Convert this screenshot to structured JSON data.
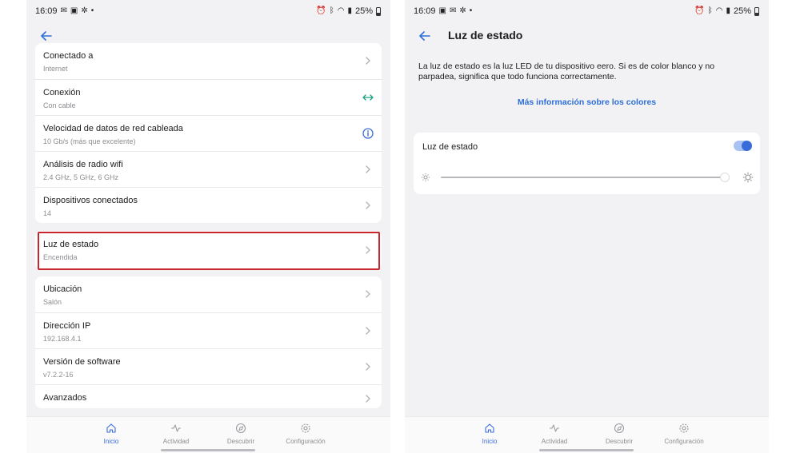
{
  "status_bar": {
    "time": "16:09",
    "battery": "25%"
  },
  "left": {
    "device_rows": [
      {
        "label": "Conectado a",
        "sub": "Internet",
        "action": "chevron-right"
      },
      {
        "label": "Conexión",
        "sub": "Con cable",
        "action": "link-arrows"
      },
      {
        "label": "Velocidad de datos de red cableada",
        "sub": "10 Gb/s (más que excelente)",
        "action": "info"
      },
      {
        "label": "Análisis de radio wifi",
        "sub": "2.4 GHz, 5 GHz, 6 GHz",
        "action": "chevron-right"
      },
      {
        "label": "Dispositivos conectados",
        "sub": "14",
        "action": "chevron-right"
      }
    ],
    "status_row": {
      "label": "Luz de estado",
      "sub": "Encendida",
      "action": "chevron-right"
    },
    "info_rows": [
      {
        "label": "Ubicación",
        "sub": "Salón",
        "action": "chevron-right"
      },
      {
        "label": "Dirección IP",
        "sub": "192.168.4.1",
        "action": "chevron-right"
      },
      {
        "label": "Versión de software",
        "sub": "v7.2.2-16",
        "action": "chevron-right"
      },
      {
        "label": "Avanzados",
        "sub": "",
        "action": "chevron-right"
      }
    ]
  },
  "right": {
    "title": "Luz de estado",
    "description": "La luz de estado es la luz LED de tu dispositivo eero. Si es de color blanco y no parpadea, significa que todo funciona correctamente.",
    "link": "Más información sobre los colores",
    "toggle_label": "Luz de estado",
    "toggle_on": true,
    "brightness_fraction": 1.0
  },
  "tabs": [
    {
      "label": "Inicio",
      "icon": "home-icon",
      "active": true
    },
    {
      "label": "Actividad",
      "icon": "activity-icon",
      "active": false
    },
    {
      "label": "Descubrir",
      "icon": "discover-icon",
      "active": false
    },
    {
      "label": "Configuración",
      "icon": "gear-icon",
      "active": false
    }
  ],
  "colors": {
    "accent": "#3a6cd9",
    "link": "#2d6fd8",
    "link_arrows": "#1aa383",
    "highlight": "#c8252c"
  }
}
